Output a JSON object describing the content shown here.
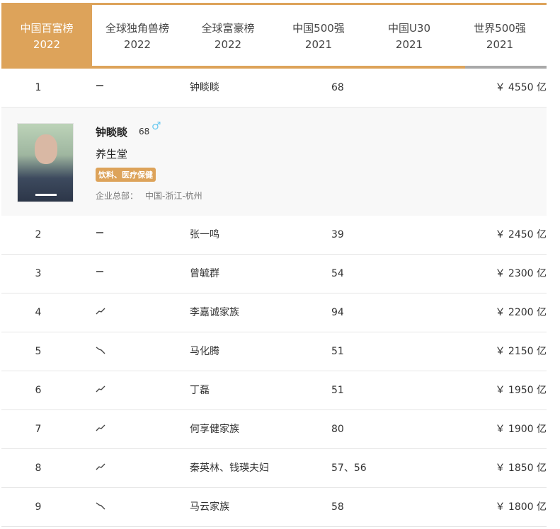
{
  "tabs": [
    {
      "title": "中国百富榜",
      "year": "2022"
    },
    {
      "title": "全球独角兽榜",
      "year": "2022"
    },
    {
      "title": "全球富豪榜",
      "year": "2022"
    },
    {
      "title": "中国500强",
      "year": "2021"
    },
    {
      "title": "中国U30",
      "year": "2021"
    },
    {
      "title": "世界500强",
      "year": "2021"
    }
  ],
  "detail": {
    "name": "钟睒睒",
    "age": "68",
    "gender": "♂",
    "company": "养生堂",
    "industry": "饮料、医疗保健",
    "hq_label": "企业总部：",
    "hq": "中国-浙江-杭州"
  },
  "rows": [
    {
      "rank": "1",
      "trend": "flat",
      "name": "钟睒睒",
      "age": "68",
      "worth": "￥ 4550 亿"
    },
    {
      "rank": "2",
      "trend": "flat",
      "name": "张一鸣",
      "age": "39",
      "worth": "￥ 2450 亿"
    },
    {
      "rank": "3",
      "trend": "flat",
      "name": "曾毓群",
      "age": "54",
      "worth": "￥ 2300 亿"
    },
    {
      "rank": "4",
      "trend": "up",
      "name": "李嘉诚家族",
      "age": "94",
      "worth": "￥ 2200 亿"
    },
    {
      "rank": "5",
      "trend": "down",
      "name": "马化腾",
      "age": "51",
      "worth": "￥ 2150 亿"
    },
    {
      "rank": "6",
      "trend": "up",
      "name": "丁磊",
      "age": "51",
      "worth": "￥ 1950 亿"
    },
    {
      "rank": "7",
      "trend": "up",
      "name": "何享健家族",
      "age": "80",
      "worth": "￥ 1900 亿"
    },
    {
      "rank": "8",
      "trend": "up",
      "name": "秦英林、钱瑛夫妇",
      "age": "57、56",
      "worth": "￥ 1850 亿"
    },
    {
      "rank": "9",
      "trend": "down",
      "name": "马云家族",
      "age": "58",
      "worth": "￥ 1800 亿"
    }
  ]
}
